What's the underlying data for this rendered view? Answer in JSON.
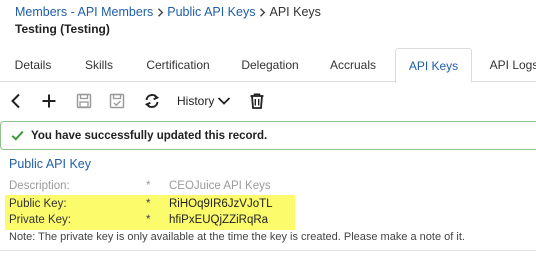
{
  "breadcrumb": {
    "items": [
      "Members - API Members",
      "Public API Keys",
      "API Keys"
    ]
  },
  "record": {
    "title": "Testing (Testing)"
  },
  "tabs": [
    {
      "label": "Details"
    },
    {
      "label": "Skills"
    },
    {
      "label": "Certification"
    },
    {
      "label": "Delegation"
    },
    {
      "label": "Accruals"
    },
    {
      "label": "API Keys"
    },
    {
      "label": "API Logs"
    }
  ],
  "active_tab": "API Keys",
  "toolbar": {
    "icons": [
      "back-icon",
      "add-icon",
      "save-icon",
      "save-and-close-icon",
      "refresh-icon",
      "history-chevron-icon",
      "delete-icon"
    ],
    "history_label": "History"
  },
  "alert": {
    "icon": "check-icon",
    "text": "You have successfully updated this record."
  },
  "section": {
    "title": "Public API Key"
  },
  "fields": {
    "description": {
      "label": "Description:",
      "required_marker": "*",
      "value": "CEOJuice API Keys"
    },
    "public_key": {
      "label": "Public Key:",
      "required_marker": "*",
      "value": "RiHOq9IR6JzVJoTL"
    },
    "private_key": {
      "label": "Private Key:",
      "required_marker": "*",
      "value": "hfiPxEUQjZZiRqRa"
    }
  },
  "note": "Note: The private key is only available at the time the key is created. Please make a note of it.",
  "colors": {
    "link": "#1f5fa8",
    "highlight": "#fbfb6b",
    "success_border": "#8fc28a",
    "success_check": "#3a9a3a"
  }
}
